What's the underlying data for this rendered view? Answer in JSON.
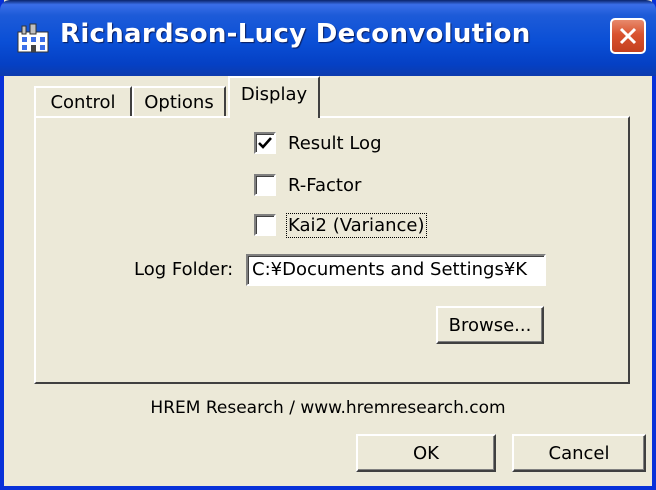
{
  "window": {
    "title": "Richardson-Lucy Deconvolution",
    "app_icon": "building-icon",
    "close_icon": "close-icon"
  },
  "tabs": [
    {
      "label": "Control",
      "selected": false
    },
    {
      "label": "Options",
      "selected": false
    },
    {
      "label": "Display",
      "selected": true
    }
  ],
  "display": {
    "checkboxes": [
      {
        "label": "Result Log",
        "checked": true
      },
      {
        "label": "R-Factor",
        "checked": false
      },
      {
        "label": "Kai2 (Variance)",
        "checked": false
      }
    ],
    "log_folder_label": "Log Folder:",
    "log_folder_value": "C:¥Documents and Settings¥K",
    "browse_label": "Browse..."
  },
  "footer": {
    "credit": "HREM Research / www.hremresearch.com",
    "ok_label": "OK",
    "cancel_label": "Cancel"
  },
  "colors": {
    "titlebar": "#0a4fd6",
    "close_button": "#d9532f",
    "dialog_bg": "#ece9d8"
  }
}
